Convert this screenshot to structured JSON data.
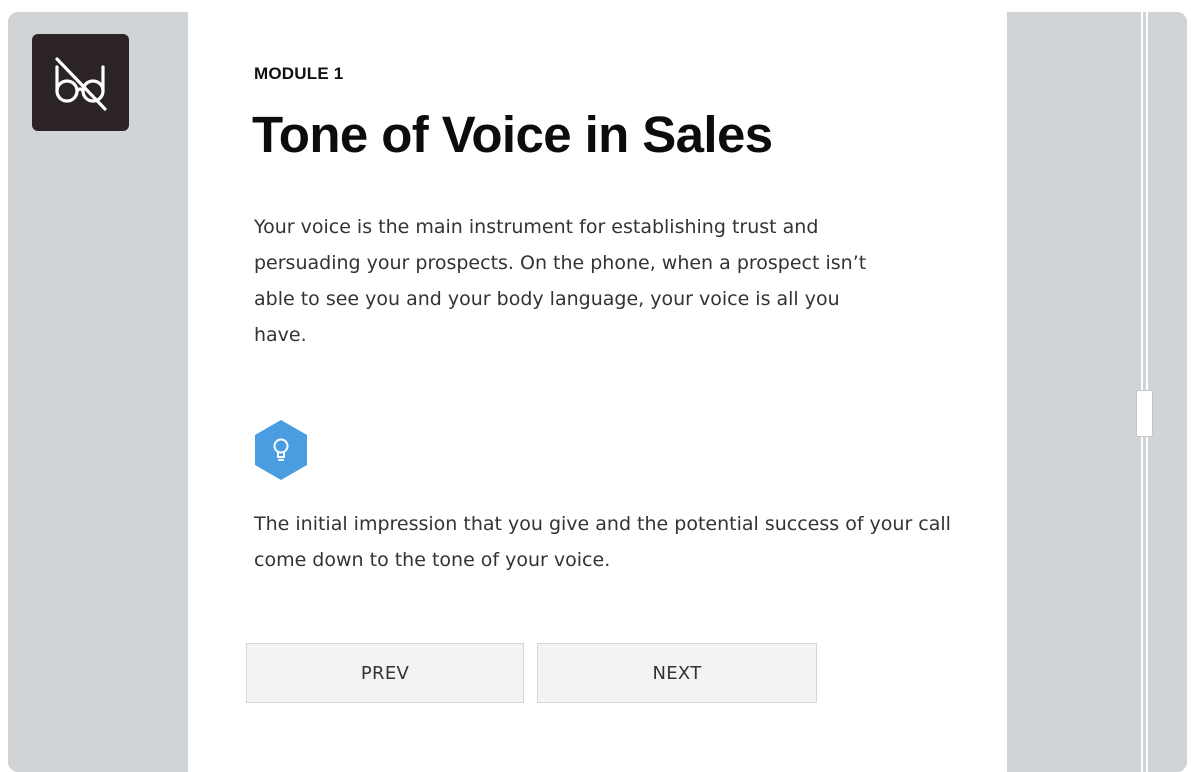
{
  "logo": {
    "icon": "glasses-crossed-icon",
    "background": "#2b2325"
  },
  "module": {
    "label": "MODULE 1",
    "title": "Tone of Voice in Sales",
    "paragraphs": [
      "Your voice is the main instrument for establishing trust and persuading your prospects. On the phone, when a prospect isn’t able to see you and your body language, your voice is all you have.",
      "The initial impression that you give and the potential success of your call come down to the tone of your voice."
    ],
    "tip_icon": "lightbulb-icon",
    "tip_color": "#4a9de0"
  },
  "nav": {
    "prev_label": "PREV",
    "next_label": "NEXT"
  },
  "scrollbar": {
    "position": 0.5
  },
  "colors": {
    "frame_background": "#d0d4d7",
    "panel_background": "#ffffff",
    "text": "#333333"
  }
}
